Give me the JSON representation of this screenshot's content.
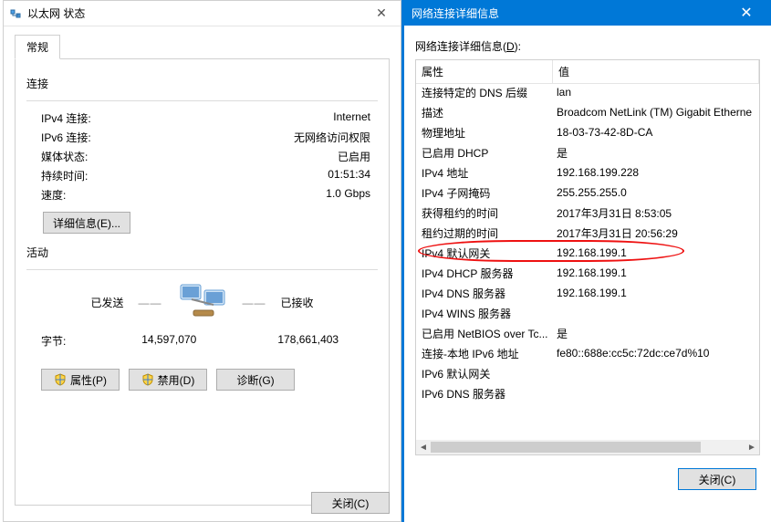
{
  "left": {
    "title": "以太网 状态",
    "tab_label": "常规",
    "conn_section": "连接",
    "rows": [
      {
        "label": "IPv4 连接:",
        "value": "Internet"
      },
      {
        "label": "IPv6 连接:",
        "value": "无网络访问权限"
      },
      {
        "label": "媒体状态:",
        "value": "已启用"
      },
      {
        "label": "持续时间:",
        "value": "01:51:34"
      },
      {
        "label": "速度:",
        "value": "1.0 Gbps"
      }
    ],
    "details_btn": "详细信息(E)...",
    "activity_section": "活动",
    "sent_label": "已发送",
    "recv_label": "已接收",
    "bytes_label": "字节:",
    "bytes_sent": "14,597,070",
    "bytes_recv": "178,661,403",
    "prop_btn": "属性(P)",
    "disable_btn": "禁用(D)",
    "diag_btn": "诊断(G)",
    "close_btn": "关闭(C)"
  },
  "right": {
    "title": "网络连接详细信息",
    "details_label_prefix": "网络连接详细信息(",
    "details_label_u": "D",
    "details_label_suffix": "):",
    "col_prop": "属性",
    "col_val": "值",
    "rows": [
      {
        "p": "连接特定的 DNS 后缀",
        "v": "lan"
      },
      {
        "p": "描述",
        "v": "Broadcom NetLink (TM) Gigabit Etherne"
      },
      {
        "p": "物理地址",
        "v": "18-03-73-42-8D-CA"
      },
      {
        "p": "已启用 DHCP",
        "v": "是"
      },
      {
        "p": "IPv4 地址",
        "v": "192.168.199.228"
      },
      {
        "p": "IPv4 子网掩码",
        "v": "255.255.255.0"
      },
      {
        "p": "获得租约的时间",
        "v": "2017年3月31日 8:53:05"
      },
      {
        "p": "租约过期的时间",
        "v": "2017年3月31日 20:56:29"
      },
      {
        "p": "IPv4 默认网关",
        "v": "192.168.199.1"
      },
      {
        "p": "IPv4 DHCP 服务器",
        "v": "192.168.199.1"
      },
      {
        "p": "IPv4 DNS 服务器",
        "v": "192.168.199.1"
      },
      {
        "p": "IPv4 WINS 服务器",
        "v": ""
      },
      {
        "p": "已启用 NetBIOS over Tc...",
        "v": "是"
      },
      {
        "p": "连接-本地 IPv6 地址",
        "v": "fe80::688e:cc5c:72dc:ce7d%10"
      },
      {
        "p": "IPv6 默认网关",
        "v": ""
      },
      {
        "p": "IPv6 DNS 服务器",
        "v": ""
      }
    ],
    "highlight_index": 8,
    "close_btn": "关闭(C)"
  }
}
